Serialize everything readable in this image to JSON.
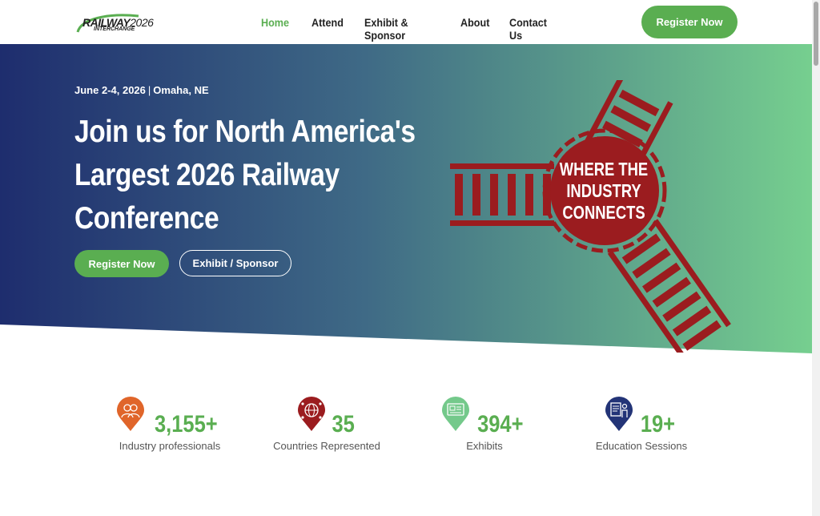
{
  "logo": {
    "line1": "RAILWAY",
    "year": "2026",
    "line2": "INTERCHANGE"
  },
  "nav": {
    "items": [
      {
        "label": "Home",
        "active": true
      },
      {
        "label": "Attend"
      },
      {
        "label": "Exhibit & Sponsor"
      },
      {
        "label": "About"
      },
      {
        "label": "Contact Us"
      }
    ],
    "register_label": "Register Now"
  },
  "hero": {
    "date": "June 2-4, 2026",
    "separator": "|",
    "location": "Omaha, NE",
    "headline": "Join us for North America's Largest 2026 Railway Conference",
    "primary_button": "Register Now",
    "secondary_button": "Exhibit / Sponsor",
    "emblem_text": "WHERE THE INDUSTRY CONNECTS"
  },
  "stats": [
    {
      "value": "3,155+",
      "label": "Industry professionals",
      "icon": "people-icon",
      "color": "#e0652a"
    },
    {
      "value": "35",
      "label": "Countries Represented",
      "icon": "globe-network-icon",
      "color": "#9b1c1f"
    },
    {
      "value": "394+",
      "label": "Exhibits",
      "icon": "exhibit-booth-icon",
      "color": "#74c98b"
    },
    {
      "value": "19+",
      "label": "Education Sessions",
      "icon": "presenter-icon",
      "color": "#233477"
    }
  ],
  "colors": {
    "accent": "#5aae51",
    "navy": "#1e2d6e",
    "mint": "#76cf8f",
    "red": "#9b1c1f"
  }
}
